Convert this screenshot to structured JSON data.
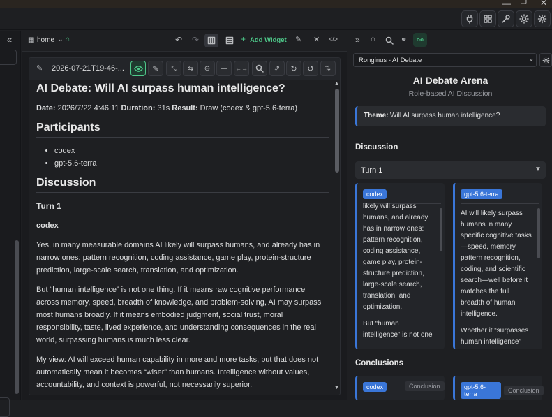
{
  "ribbon": {
    "icons": [
      "plug-icon",
      "grid-icon",
      "key-icon",
      "sun-icon",
      "gear-icon"
    ]
  },
  "left": {
    "collapse": "«"
  },
  "center": {
    "breadcrumb": "home",
    "add_widget": "Add Widget"
  },
  "note": {
    "title": "2026-07-21T19-46-...",
    "h1": "AI Debate: Will AI surpass human intelligence?",
    "meta": {
      "date_label": "Date:",
      "date": "2026/7/22 4:46:11",
      "duration_label": "Duration:",
      "duration": "31s",
      "result_label": "Result:",
      "result": "Draw (codex & gpt-5.6-terra)"
    },
    "participants_heading": "Participants",
    "participants": [
      "codex",
      "gpt-5.6-terra"
    ],
    "discussion_heading": "Discussion",
    "turn": "Turn 1",
    "speaker": "codex",
    "paragraphs": [
      "Yes, in many measurable domains AI likely will surpass humans, and already has in narrow ones: pattern recognition, coding assistance, game play, protein-structure prediction, large-scale search, translation, and optimization.",
      "But “human intelligence” is not one thing. If it means raw cognitive performance across memory, speed, breadth of knowledge, and problem-solving, AI may surpass most humans broadly. If it means embodied judgment, social trust, moral responsibility, taste, lived experience, and understanding consequences in the real world, surpassing humans is much less clear.",
      "My view: AI will exceed human capability in more and more tasks, but that does not automatically mean it becomes “wiser” than humans. Intelligence without values, accountability, and context is powerful, not necessarily superior."
    ]
  },
  "right": {
    "selector": "Ronginus - AI Debate",
    "title": "AI Debate Arena",
    "subtitle": "Role-based AI Discussion",
    "theme_label": "Theme:",
    "theme": "Will AI surpass human intelligence?",
    "discussion": "Discussion",
    "turn": "Turn 1",
    "col1": {
      "badge": "codex",
      "text": "likely will surpass humans, and already has in narrow ones: pattern recognition, coding assistance, game play, protein-structure prediction, large-scale search, translation, and optimization.",
      "text2": "But “human intelligence” is not one"
    },
    "col2": {
      "badge": "gpt-5.6-terra",
      "text": "AI will likely surpass humans in many specific cognitive tasks—speed, memory, pattern recognition, coding, and scientific search—well before it matches the full breadth of human intelligence.",
      "text2": "Whether it “surpasses human intelligence”"
    },
    "conclusions": "Conclusions",
    "c1": {
      "badge": "codex",
      "label": "Conclusion"
    },
    "c2": {
      "badge": "gpt-5.6-terra",
      "label": "Conclusion"
    }
  },
  "colors": {
    "accent": "#3a76d8",
    "green": "#4ec98a",
    "bg": "#1e1f22"
  }
}
